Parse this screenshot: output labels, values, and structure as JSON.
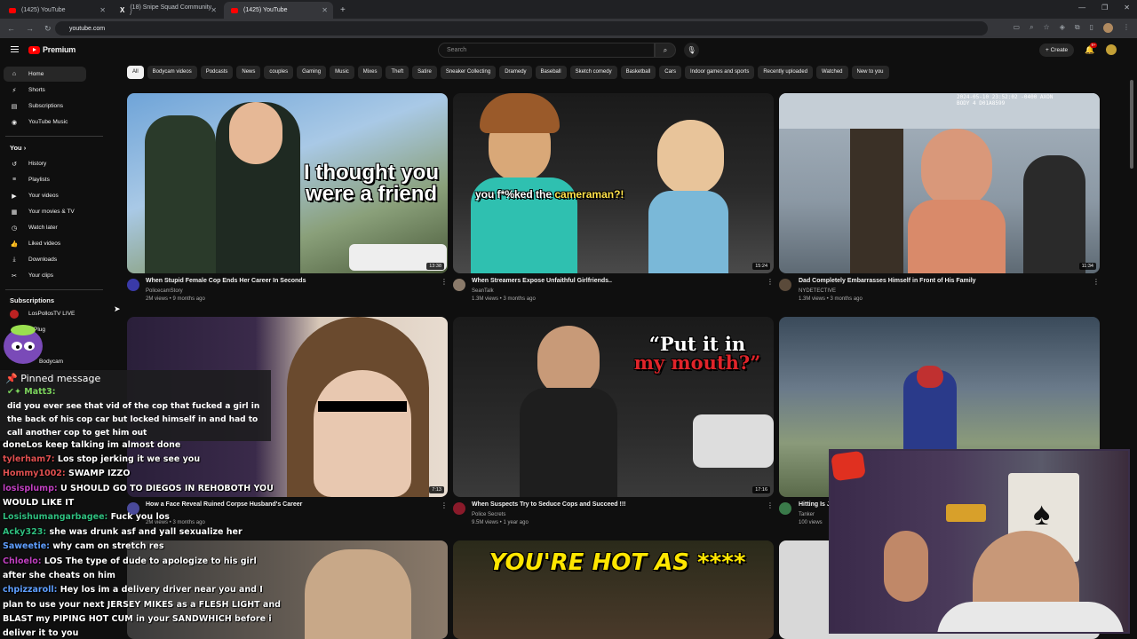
{
  "browser": {
    "tabs": [
      {
        "title": "(1425) YouTube",
        "favicon": "youtube-icon"
      },
      {
        "title": "(18) Snipe Squad Community /",
        "favicon": "x-icon"
      },
      {
        "title": "(1425) YouTube",
        "favicon": "youtube-icon"
      }
    ],
    "url": "youtube.com"
  },
  "header": {
    "logo_text": "Premium",
    "search_placeholder": "Search",
    "create_label": "Create",
    "notif_count": "9+"
  },
  "sidebar": {
    "main": [
      {
        "label": "Home",
        "icon": "home-icon"
      },
      {
        "label": "Shorts",
        "icon": "shorts-icon"
      },
      {
        "label": "Subscriptions",
        "icon": "subscriptions-icon"
      },
      {
        "label": "YouTube Music",
        "icon": "music-icon"
      }
    ],
    "you_heading": "You",
    "you": [
      {
        "label": "History",
        "icon": "history-icon"
      },
      {
        "label": "Playlists",
        "icon": "playlists-icon"
      },
      {
        "label": "Your videos",
        "icon": "your-videos-icon"
      },
      {
        "label": "Your movies & TV",
        "icon": "movies-icon"
      },
      {
        "label": "Watch later",
        "icon": "clock-icon"
      },
      {
        "label": "Liked videos",
        "icon": "like-icon"
      },
      {
        "label": "Downloads",
        "icon": "download-icon"
      },
      {
        "label": "Your clips",
        "icon": "scissors-icon"
      }
    ],
    "subs_heading": "Subscriptions",
    "subs": [
      {
        "label": "LosPollosTV LIVE"
      },
      {
        "label": "Plug"
      },
      {
        "label": "Bodycam"
      }
    ]
  },
  "chips": [
    "All",
    "Bodycam videos",
    "Podcasts",
    "News",
    "couples",
    "Gaming",
    "Music",
    "Mixes",
    "Theft",
    "Satire",
    "Sneaker Collecting",
    "Dramedy",
    "Baseball",
    "Sketch comedy",
    "Basketball",
    "Cars",
    "Indoor games and sports",
    "Recently uploaded",
    "Watched",
    "New to you"
  ],
  "videos": [
    {
      "title": "When Stupid Female Cop Ends Her Career In Seconds",
      "channel": "PolicecamStory",
      "meta": "2M views • 9 months ago",
      "duration": "13:38",
      "thumb_text": "I thought you were a friend"
    },
    {
      "title": "When Streamers Expose Unfaithful Girlfriends..",
      "channel": "SeanTalk",
      "meta": "1.3M views • 3 months ago",
      "duration": "15:24",
      "thumb_text_a": "you f*%ked the ",
      "thumb_text_b": "cameraman?!"
    },
    {
      "title": "Dad Completely Embarrasses Himself in Front of His Family",
      "channel": "NYDETECTIVE",
      "meta": "1.3M views • 3 months ago",
      "duration": "11:34",
      "thumb_text": "2024-05-10 23:52:02 -0400 AXON BODY 4 D01A8599"
    },
    {
      "title": "How a Face Reveal Ruined Corpse Husband's Career",
      "channel": "",
      "meta": "2M views • 3 months ago",
      "duration": "7:13"
    },
    {
      "title": "When Suspects Try to Seduce Cops and Succeed !!!",
      "channel": "Police Secrets",
      "meta": "9.5M views • 1 year ago",
      "duration": "17:16",
      "thumb_text_a": "“Put it in",
      "thumb_text_b": "my mouth?”"
    },
    {
      "title": "Hitting Is J",
      "channel": "Tanker",
      "meta": "100 views",
      "duration": ""
    },
    {
      "title": "",
      "channel": "",
      "meta": "",
      "duration": "",
      "thumb_text": "YOU'RE HOT AS ****"
    }
  ],
  "chat": {
    "pinned_header": "Pinned message",
    "pinned_user": "Matt3:",
    "pinned_text": "did you ever see that vid of the cop that fucked a girl in the back of his cop car but locked himself in and had to call another cop to get him out",
    "messages": [
      {
        "user": "",
        "text": "doneLos keep talking im almost done"
      },
      {
        "user": "tylerham7:",
        "text": "Los stop jerking it we see you",
        "color": "#e05050"
      },
      {
        "user": "Hommy1002:",
        "text": "SWAMP IZZO",
        "color": "#e05050"
      },
      {
        "user": "losisplump:",
        "text": "U SHOULD GO TO DIEGOS IN REHOBOTH YOU",
        "color": "#c040c0"
      },
      {
        "user": "",
        "text": "WOULD LIKE IT"
      },
      {
        "user": "Losishumangarbagee:",
        "text": "Fuck you los",
        "color": "#2fbf7f"
      },
      {
        "user": "Acky323:",
        "text": "she was drunk asf and yall sexualize her",
        "color": "#2fbf7f"
      },
      {
        "user": "Saweetie:",
        "text": "why cam on stretch res",
        "color": "#5f9fff"
      },
      {
        "user": "Chloelo:",
        "text": "LOS The type of dude to apologize to his girl",
        "color": "#c040c0"
      },
      {
        "user": "",
        "text": "after she cheats on him"
      },
      {
        "user": "chpizzaroll:",
        "text": "Hey los im a delivery driver near you and I",
        "color": "#5f9fff"
      },
      {
        "user": "",
        "text": "plan to use your next JERSEY MIKES as a FLESH LIGHT and"
      },
      {
        "user": "",
        "text": "BLAST my PIPING HOT CUM in your SANDWHICH before i"
      },
      {
        "user": "",
        "text": "deliver it to you"
      }
    ]
  },
  "colors": {
    "bg": "#0f0f0f",
    "brand": "#ff0000",
    "chip": "#272727"
  }
}
